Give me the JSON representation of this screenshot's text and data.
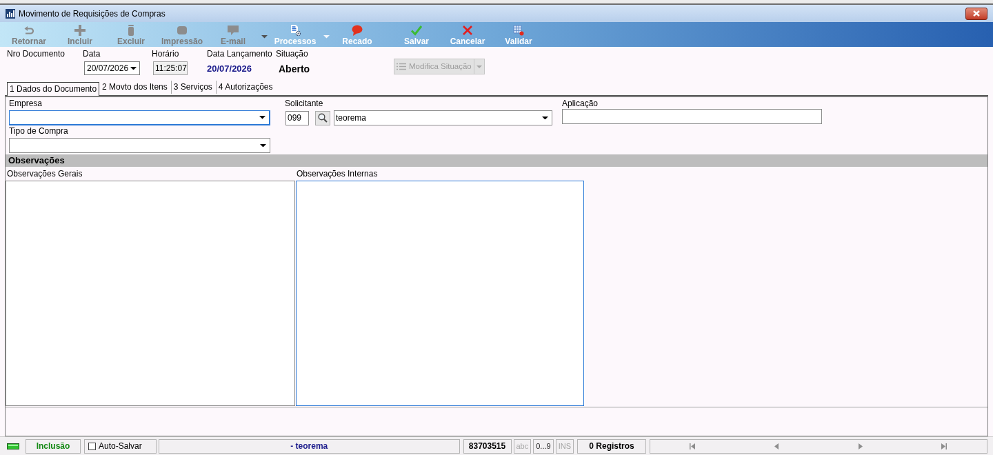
{
  "window": {
    "title": "Movimento de Requisições de Compras"
  },
  "toolbar": {
    "groups": [
      [
        {
          "label": "Retornar",
          "disabled": true,
          "has_menu": false
        },
        {
          "label": "Incluir",
          "disabled": true,
          "has_menu": false
        },
        {
          "label": "Excluir",
          "disabled": true,
          "has_menu": false
        },
        {
          "label": "Impressão",
          "disabled": true,
          "has_menu": false
        },
        {
          "label": "E-mail",
          "disabled": true,
          "has_menu": true
        },
        {
          "label": "Processos",
          "disabled": false,
          "has_menu": true
        },
        {
          "label": "Recado",
          "disabled": false,
          "has_menu": false
        }
      ],
      [
        {
          "label": "Salvar",
          "disabled": false,
          "has_menu": false
        },
        {
          "label": "Cancelar",
          "disabled": false,
          "has_menu": false
        },
        {
          "label": "Validar",
          "disabled": false,
          "has_menu": false
        }
      ]
    ]
  },
  "header": {
    "fields": [
      {
        "label": "Nro Documento",
        "kind": "empty"
      },
      {
        "label": "Data",
        "kind": "date",
        "value": "20/07/2026"
      },
      {
        "label": "Horário",
        "kind": "time",
        "value": "11:25:07"
      },
      {
        "label": "Data Lançamento",
        "kind": "info",
        "value": "20/07/2026"
      },
      {
        "label": "Situação",
        "kind": "status",
        "value": "Aberto"
      }
    ],
    "modify_button": {
      "label": "Modifica Situação",
      "disabled": true
    }
  },
  "tabs": [
    {
      "label": "1 Dados do Documento",
      "selected": true
    },
    {
      "label": "2 Movto dos Itens",
      "selected": false
    },
    {
      "label": "3 Serviços",
      "selected": false
    },
    {
      "label": "4 Autorizações",
      "selected": false
    }
  ],
  "form": {
    "empresa": {
      "label": "Empresa",
      "highlighted": true
    },
    "solicitante": {
      "label": "Solicitante",
      "code": "099",
      "value": "teorema"
    },
    "aplicacao": {
      "label": "Aplicação"
    },
    "tipo_de_compra": {
      "label": "Tipo de Compra"
    }
  },
  "observacoes": {
    "title": "Observações",
    "notes": [
      {
        "label": "Observações Gerais",
        "highlighted": false
      },
      {
        "label": "Observações Internas",
        "highlighted": true
      }
    ]
  },
  "status_bar": {
    "mode": "Inclusão",
    "auto_save": {
      "label": "Auto-Salvar",
      "checked": false
    },
    "user": "- teorema",
    "code": "83703515",
    "indicators": [
      {
        "label": "abc",
        "active": false
      },
      {
        "label": "0...9",
        "active": true
      },
      {
        "label": "INS",
        "active": false
      }
    ],
    "records": "0 Registros"
  }
}
